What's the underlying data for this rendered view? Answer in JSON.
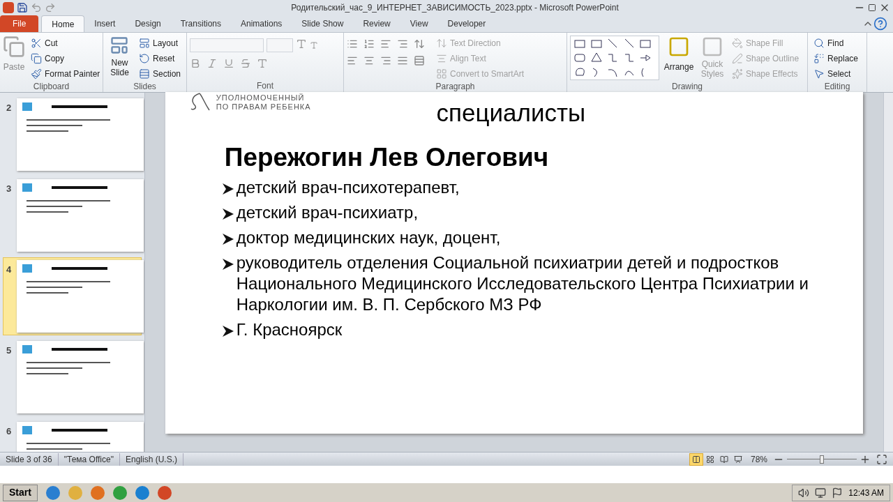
{
  "window": {
    "title": "Родительский_час_9_ИНТЕРНЕТ_ЗАВИСИМОСТЬ_2023.pptx - Microsoft PowerPoint"
  },
  "tabs": [
    {
      "label": "File",
      "kind": "file",
      "selected": false
    },
    {
      "label": "Home",
      "kind": "tab",
      "selected": true
    },
    {
      "label": "Insert",
      "kind": "tab",
      "selected": false
    },
    {
      "label": "Design",
      "kind": "tab",
      "selected": false
    },
    {
      "label": "Transitions",
      "kind": "tab",
      "selected": false
    },
    {
      "label": "Animations",
      "kind": "tab",
      "selected": false
    },
    {
      "label": "Slide Show",
      "kind": "tab",
      "selected": false
    },
    {
      "label": "Review",
      "kind": "tab",
      "selected": false
    },
    {
      "label": "View",
      "kind": "tab",
      "selected": false
    },
    {
      "label": "Developer",
      "kind": "tab",
      "selected": false
    }
  ],
  "ribbon": {
    "clipboard": {
      "label": "Clipboard",
      "paste": {
        "label": "Paste",
        "disabled": true
      },
      "items": [
        {
          "label": "Cut",
          "disabled": false
        },
        {
          "label": "Copy",
          "disabled": false
        },
        {
          "label": "Format Painter",
          "disabled": false
        }
      ]
    },
    "slides": {
      "label": "Slides",
      "new_slide": {
        "label": "New Slide"
      },
      "items": [
        {
          "label": "Layout",
          "disabled": false
        },
        {
          "label": "Reset",
          "disabled": false
        },
        {
          "label": "Section",
          "disabled": false
        }
      ]
    },
    "font": {
      "label": "Font"
    },
    "paragraph": {
      "label": "Paragraph",
      "items": [
        {
          "label": "Text Direction",
          "disabled": true
        },
        {
          "label": "Align Text",
          "disabled": true
        },
        {
          "label": "Convert to SmartArt",
          "disabled": true
        }
      ]
    },
    "drawing": {
      "label": "Drawing",
      "arrange": {
        "label": "Arrange"
      },
      "quick_styles": {
        "label": "Quick Styles",
        "disabled": true
      },
      "items": [
        {
          "label": "Shape Fill",
          "disabled": true
        },
        {
          "label": "Shape Outline",
          "disabled": true
        },
        {
          "label": "Shape Effects",
          "disabled": true
        }
      ]
    },
    "editing": {
      "label": "Editing",
      "items": [
        {
          "label": "Find",
          "disabled": false
        },
        {
          "label": "Replace",
          "disabled": false
        },
        {
          "label": "Select",
          "disabled": false
        }
      ]
    }
  },
  "thumbnails": [
    {
      "number": "2",
      "selected": false
    },
    {
      "number": "3",
      "selected": false
    },
    {
      "number": "4",
      "selected": true
    },
    {
      "number": "5",
      "selected": false
    },
    {
      "number": "6",
      "selected": false
    }
  ],
  "slide": {
    "logo_lines": [
      "УПОЛНОМОЧЕННЫЙ",
      "ПО ПРАВАМ РЕБЕНКА"
    ],
    "title": "специалисты",
    "heading": "Пережогин Лев Олегович",
    "bullets": [
      "детский врач-психотерапевт,",
      "детский врач-психиатр,",
      "доктор медицинских наук, доцент,",
      "руководитель отделения Социальной психиатрии детей и подростков  Национального Медицинского Исследовательского Центра Психиатрии и Наркологии им. В. П. Сербского МЗ РФ",
      "Г. Красноярск"
    ]
  },
  "status_bar": {
    "items": [
      "Slide 3 of 36",
      "\"Тема Office\"",
      "English (U.S.)"
    ],
    "zoom": "78%",
    "zoom_slider": {
      "level": 0.5
    },
    "views": [
      {
        "selected": true
      },
      {
        "selected": false
      },
      {
        "selected": false
      },
      {
        "selected": false
      }
    ]
  },
  "taskbar": {
    "start": "Start",
    "clock": "12:43 AM"
  }
}
